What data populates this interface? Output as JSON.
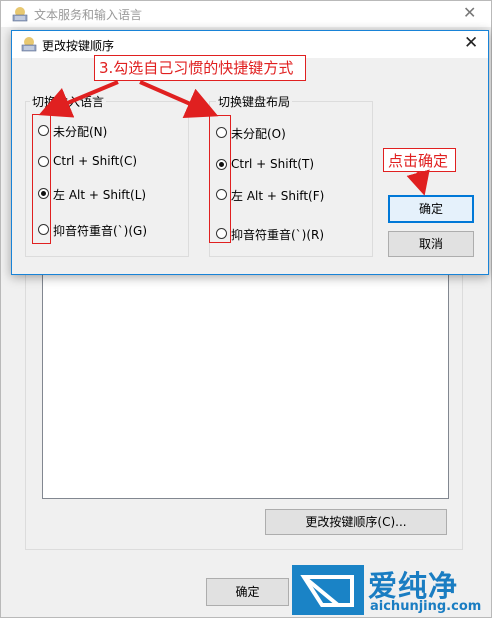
{
  "back_window": {
    "title": "文本服务和输入语言",
    "change_hotkey_button": "更改按键顺序(C)...",
    "ok_button": "确定"
  },
  "dialog": {
    "title": "更改按键顺序",
    "input_language_group": {
      "label": "切换输入语言",
      "options": [
        {
          "label": "未分配(N)",
          "checked": false
        },
        {
          "label": "Ctrl + Shift(C)",
          "checked": false
        },
        {
          "label": "左 Alt + Shift(L)",
          "checked": true
        },
        {
          "label": "抑音符重音(`)(G)",
          "checked": false
        }
      ]
    },
    "keyboard_layout_group": {
      "label": "切换键盘布局",
      "options": [
        {
          "label": "未分配(O)",
          "checked": false
        },
        {
          "label": "Ctrl + Shift(T)",
          "checked": true
        },
        {
          "label": "左 Alt + Shift(F)",
          "checked": false
        },
        {
          "label": "抑音符重音(`)(R)",
          "checked": false
        }
      ]
    },
    "ok_button": "确定",
    "cancel_button": "取消"
  },
  "annotations": {
    "step_callout": "3.勾选自己习惯的快捷键方式",
    "ok_callout": "点击确定",
    "color": "#e02020"
  },
  "watermark": {
    "brand_cn": "爱纯净",
    "url": "aichunjing.com",
    "color": "#1a7dc2"
  }
}
